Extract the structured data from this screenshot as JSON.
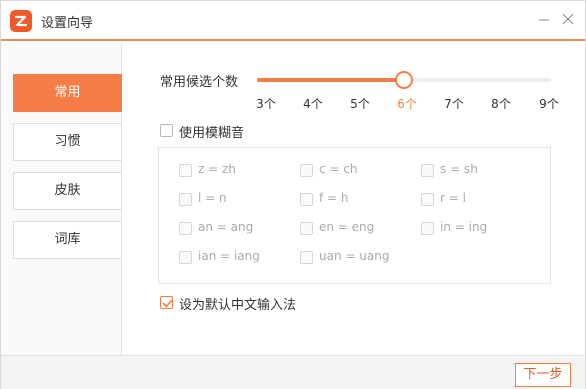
{
  "window": {
    "title": "设置向导"
  },
  "sidebar": {
    "items": [
      {
        "label": "常用",
        "active": true
      },
      {
        "label": "习惯",
        "active": false
      },
      {
        "label": "皮肤",
        "active": false
      },
      {
        "label": "词库",
        "active": false
      }
    ]
  },
  "candidates": {
    "label": "常用候选个数",
    "options": [
      "3个",
      "4个",
      "5个",
      "6个",
      "7个",
      "8个",
      "9个"
    ],
    "selected": "6个"
  },
  "fuzzy": {
    "label": "使用模糊音",
    "checked": false,
    "pairs": [
      {
        "label": "z = zh",
        "checked": false
      },
      {
        "label": "c = ch",
        "checked": false
      },
      {
        "label": "s = sh",
        "checked": false
      },
      {
        "label": "l = n",
        "checked": false
      },
      {
        "label": "f = h",
        "checked": false
      },
      {
        "label": "r = l",
        "checked": false
      },
      {
        "label": "an = ang",
        "checked": false
      },
      {
        "label": "en = eng",
        "checked": false
      },
      {
        "label": "in = ing",
        "checked": false
      },
      {
        "label": "ian = iang",
        "checked": false
      },
      {
        "label": "uan = uang",
        "checked": false
      }
    ]
  },
  "default_ime": {
    "label": "设为默认中文输入法",
    "checked": true
  },
  "footer": {
    "next_label": "下一步"
  },
  "colors": {
    "accent": "#f57d46",
    "logo": "#f05a28",
    "disabled_text": "#aaaaaa"
  }
}
